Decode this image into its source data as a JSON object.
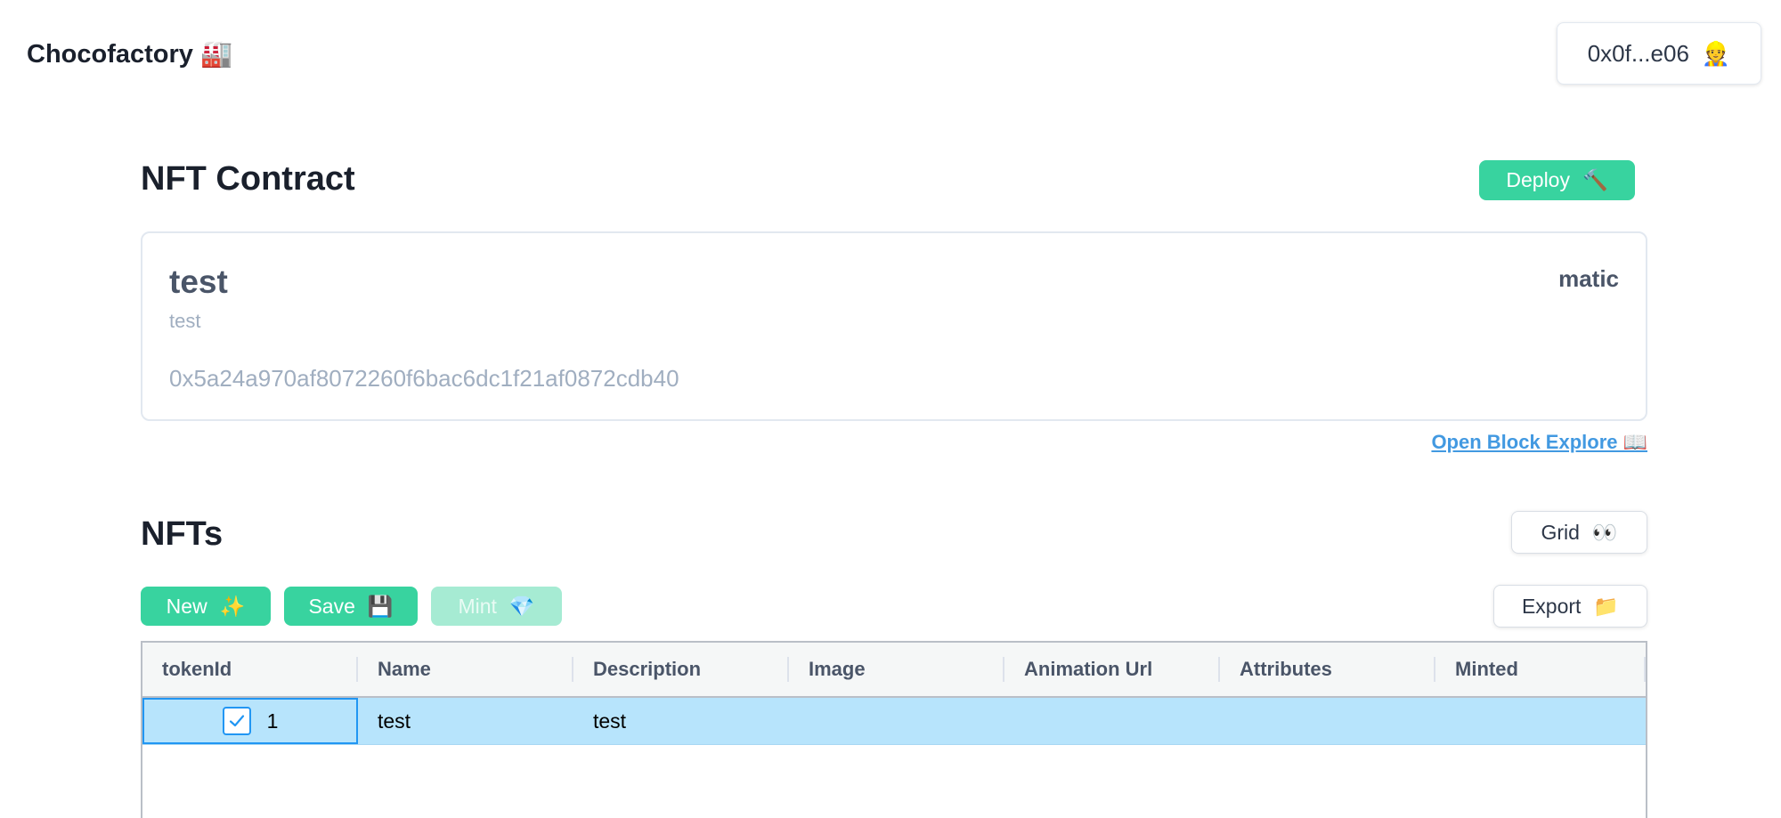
{
  "header": {
    "brand": "Chocofactory 🏭",
    "wallet": {
      "address": "0x0f...e06",
      "icon": "👷"
    }
  },
  "contract_section": {
    "title": "NFT Contract",
    "deploy_label": "Deploy",
    "deploy_icon": "🔨",
    "card": {
      "name": "test",
      "symbol": "test",
      "address": "0x5a24a970af8072260f6bac6dc1f21af0872cdb40",
      "network": "matic"
    },
    "explorer_link": "Open Block Explore 📖"
  },
  "nfts_section": {
    "title": "NFTs",
    "view_toggle": {
      "label": "Grid",
      "icon": "👀"
    },
    "toolbar": {
      "new_label": "New",
      "new_icon": "✨",
      "save_label": "Save",
      "save_icon": "💾",
      "mint_label": "Mint",
      "mint_icon": "💎",
      "export_label": "Export",
      "export_icon": "📁"
    },
    "table": {
      "columns": [
        "tokenId",
        "Name",
        "Description",
        "Image",
        "Animation Url",
        "Attributes",
        "Minted"
      ],
      "rows": [
        {
          "tokenId": "1",
          "name": "test",
          "description": "test",
          "image": "",
          "animation_url": "",
          "attributes": "",
          "minted": "",
          "selected": true
        }
      ]
    }
  },
  "colors": {
    "accent_green": "#38d39f",
    "link_blue": "#4299e1",
    "row_selected": "#b7e4fc",
    "focus_blue": "#2196f3"
  }
}
